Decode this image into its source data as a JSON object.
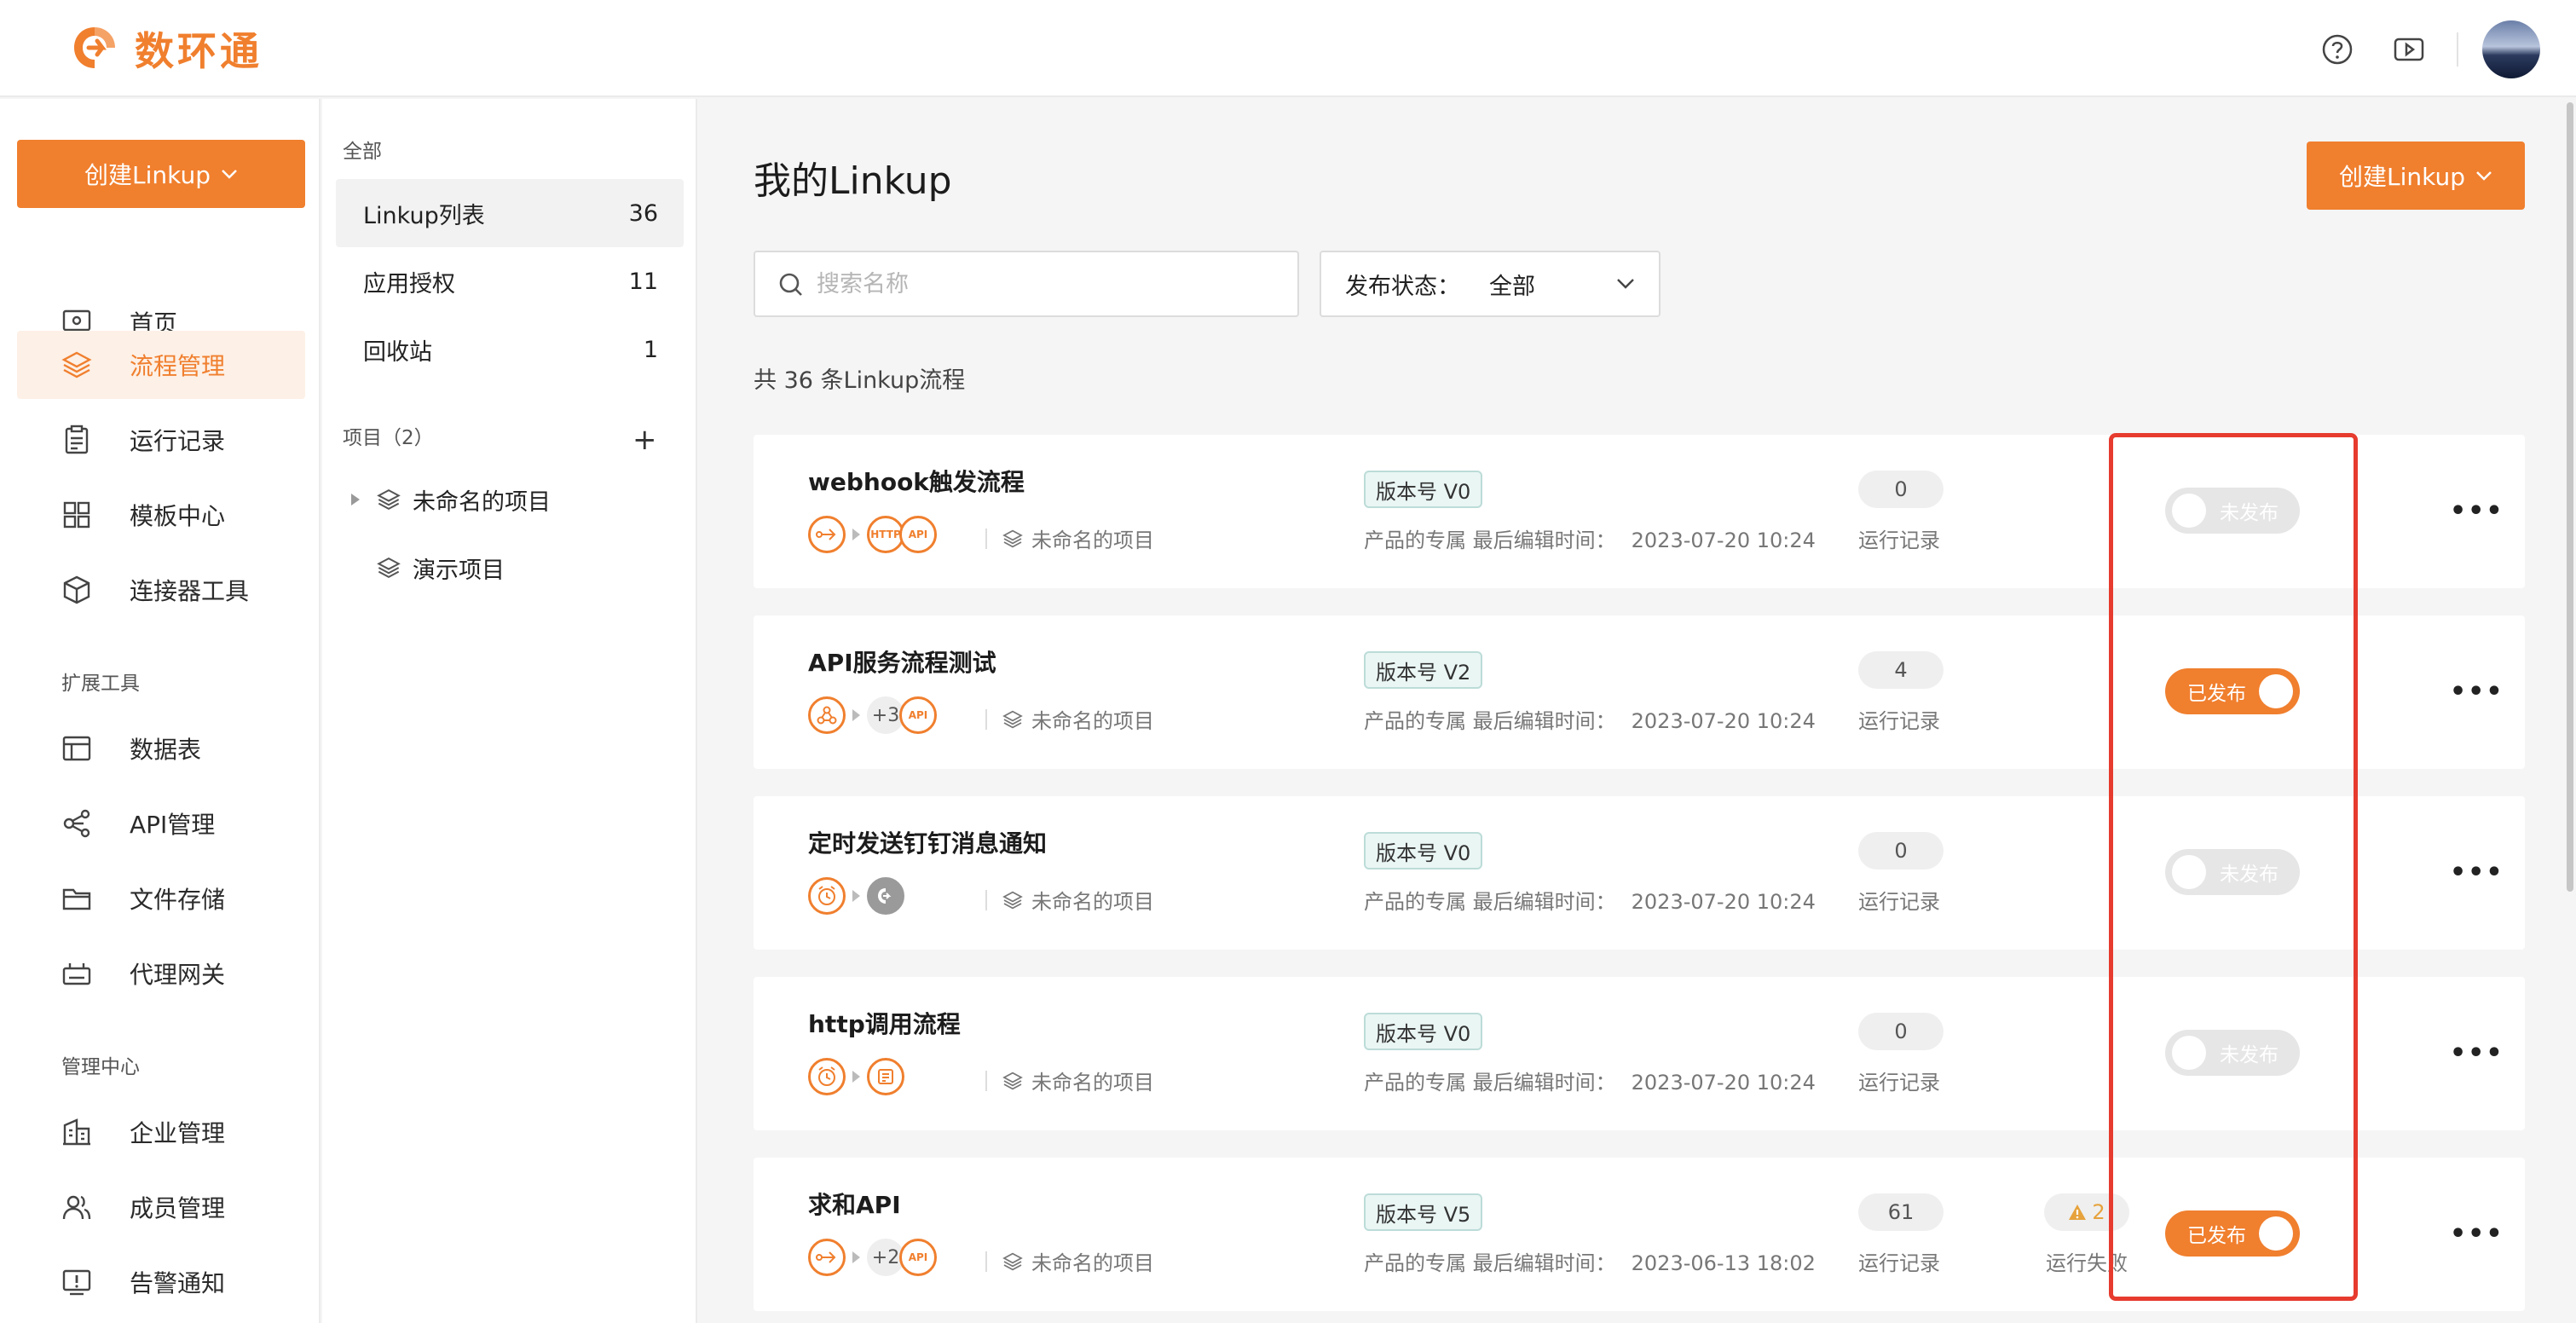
{
  "header": {
    "logo_text": "数环通",
    "icons": [
      "help-icon",
      "video-icon"
    ],
    "brand_color": "#f07f2e"
  },
  "leftnav": {
    "create_label": "创建Linkup",
    "items": [
      {
        "label": "首页",
        "icon": "monitor-icon"
      },
      {
        "label": "流程管理",
        "icon": "layers-icon",
        "active": true
      },
      {
        "label": "运行记录",
        "icon": "clipboard-icon"
      },
      {
        "label": "模板中心",
        "icon": "grid-icon"
      },
      {
        "label": "连接器工具",
        "icon": "cube-icon"
      }
    ],
    "section_ext": "扩展工具",
    "ext_items": [
      {
        "label": "数据表",
        "icon": "table-icon"
      },
      {
        "label": "API管理",
        "icon": "api-icon"
      },
      {
        "label": "文件存储",
        "icon": "folder-icon"
      },
      {
        "label": "代理网关",
        "icon": "gateway-icon"
      }
    ],
    "section_admin": "管理中心",
    "admin_items": [
      {
        "label": "企业管理",
        "icon": "building-icon"
      },
      {
        "label": "成员管理",
        "icon": "users-icon"
      },
      {
        "label": "告警通知",
        "icon": "alert-icon"
      }
    ]
  },
  "subnav": {
    "all_label": "全部",
    "items": [
      {
        "label": "Linkup列表",
        "count": "36",
        "active": true
      },
      {
        "label": "应用授权",
        "count": "11"
      },
      {
        "label": "回收站",
        "count": "1"
      }
    ],
    "projects_label": "项目（2）",
    "projects": [
      {
        "label": "未命名的项目"
      },
      {
        "label": "演示项目"
      }
    ]
  },
  "main": {
    "title": "我的Linkup",
    "create_label": "创建Linkup",
    "search_placeholder": "搜索名称",
    "filter_label": "发布状态：",
    "filter_value": "全部",
    "count_text": "共 36 条Linkup流程",
    "meta_prefix": "产品的专属 最后编辑时间：",
    "run_label": "运行记录",
    "fail_label": "运行失败",
    "flows": [
      {
        "title": "webhook触发流程",
        "version": "版本号 V0",
        "date": "2023-07-20 10:24",
        "runs": "0",
        "status": "未发布",
        "published": false,
        "project": "未命名的项目"
      },
      {
        "title": "API服务流程测试",
        "version": "版本号 V2",
        "date": "2023-07-20 10:24",
        "runs": "4",
        "status": "已发布",
        "published": true,
        "project": "未命名的项目",
        "more": "+3"
      },
      {
        "title": "定时发送钉钉消息通知",
        "version": "版本号 V0",
        "date": "2023-07-20 10:24",
        "runs": "0",
        "status": "未发布",
        "published": false,
        "project": "未命名的项目"
      },
      {
        "title": "http调用流程",
        "version": "版本号 V0",
        "date": "2023-07-20 10:24",
        "runs": "0",
        "status": "未发布",
        "published": false,
        "project": "未命名的项目"
      },
      {
        "title": "求和API",
        "version": "版本号 V5",
        "date": "2023-06-13 18:02",
        "runs": "61",
        "fails": "2",
        "status": "已发布",
        "published": true,
        "project": "未命名的项目",
        "more": "+2"
      }
    ]
  }
}
